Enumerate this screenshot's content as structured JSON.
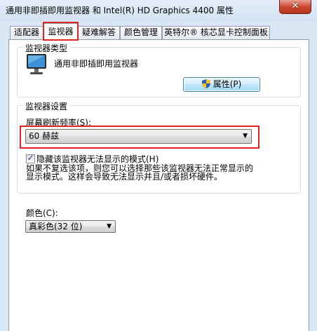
{
  "window": {
    "title": "通用非即插即用监视器 和 Intel(R) HD Graphics 4400 属性",
    "close_glyph": "✕"
  },
  "tabs": [
    {
      "label": "适配器",
      "active": false
    },
    {
      "label": "监视器",
      "active": true
    },
    {
      "label": "疑难解答",
      "active": false
    },
    {
      "label": "颜色管理",
      "active": false
    },
    {
      "label": "英特尔® 核芯显卡控制面板",
      "active": false
    }
  ],
  "monitor_type": {
    "legend": "监视器类型",
    "name": "通用非即插即用监视器",
    "properties_button": "属性(P)",
    "icons": {
      "monitor": "monitor-icon",
      "shield": "uac-shield-icon"
    }
  },
  "monitor_settings": {
    "legend": "监视器设置",
    "refresh_label": "屏幕刷新频率(S):",
    "refresh_value": "60 赫兹",
    "hide_modes_checked": true,
    "hide_modes_label": "隐藏该监视器无法显示的模式(H)",
    "description_lines": [
      "如果不复选该项，则您可以选择那些该监视器无法正常显示的",
      "显示模式。这样会导致无法显示并且/或者损坏硬件。"
    ]
  },
  "color": {
    "label": "颜色(C):",
    "value": "真彩色(32 位)"
  },
  "colors": {
    "highlight_red": "#e02424",
    "window_frame": "#d9e7f5",
    "button_border": "#3c7fb1"
  }
}
